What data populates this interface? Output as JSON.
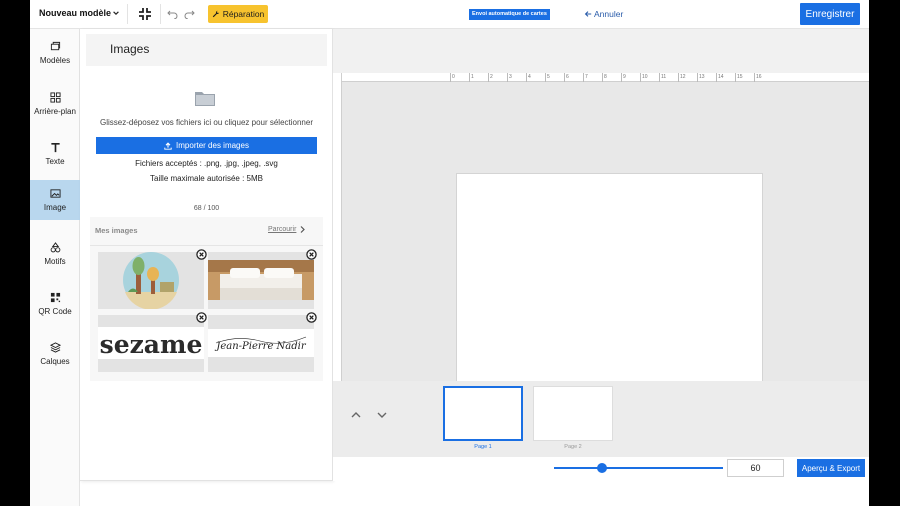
{
  "topbar": {
    "model_name": "Nouveau modèle",
    "repair_label": "Réparation",
    "auto_badge": "Envoi automatique de cartes",
    "cancel_label": "Annuler",
    "save_label": "Enregistrer"
  },
  "sidebar": {
    "items": [
      {
        "label": "Modèles",
        "icon": "layers-stack-icon"
      },
      {
        "label": "Arrière-plan",
        "icon": "grid-icon"
      },
      {
        "label": "Texte",
        "icon": "text-icon"
      },
      {
        "label": "Image",
        "icon": "image-icon",
        "active": true
      },
      {
        "label": "Motifs",
        "icon": "shapes-icon"
      },
      {
        "label": "QR Code",
        "icon": "qr-code-icon"
      },
      {
        "label": "Calques",
        "icon": "layers-icon"
      }
    ]
  },
  "panel": {
    "title": "Images",
    "drop_text": "Glissez-déposez vos fichiers ici ou cliquez pour sélectionner",
    "import_label": "Importer des images",
    "accepted": "Fichiers acceptés : .png, .jpg, .jpeg, .svg",
    "maxsize": "Taille maximale autorisée : 5MB",
    "count": "68 / 100",
    "my_images_title": "Mes images",
    "browse_label": "Parcourir",
    "images": [
      {
        "name": "illustration-trees"
      },
      {
        "name": "photo-bed"
      },
      {
        "name": "logo-sezame",
        "text": "sezame"
      },
      {
        "name": "signature",
        "text": "Jean-Pierre Nadir"
      }
    ]
  },
  "ruler": {
    "ticks": [
      "0",
      "1",
      "2",
      "3",
      "4",
      "5",
      "6",
      "7",
      "8",
      "9",
      "10",
      "11",
      "12",
      "13",
      "14",
      "15",
      "16"
    ]
  },
  "pages": [
    {
      "label": "Page 1",
      "active": true
    },
    {
      "label": "Page 2",
      "active": false
    }
  ],
  "bottombar": {
    "zoom_value": "60",
    "export_label": "Aperçu & Export"
  },
  "colors": {
    "primary": "#1a6fe3",
    "repair": "#f7c32e",
    "active_nav": "#b9d7ee"
  }
}
